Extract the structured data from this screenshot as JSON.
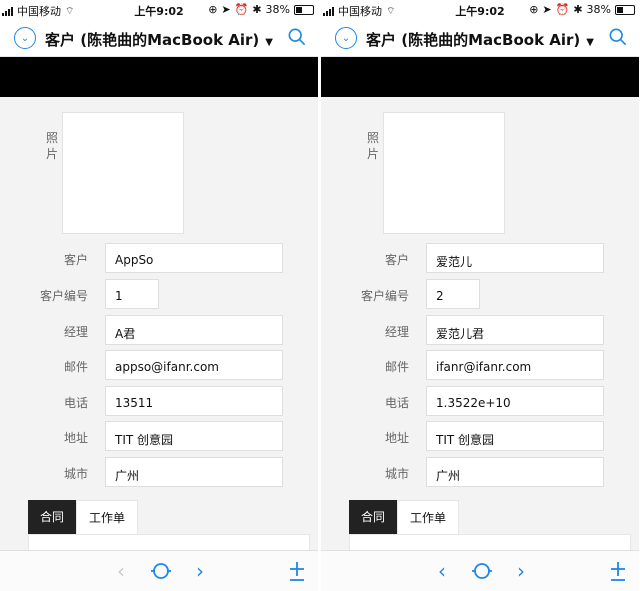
{
  "status": {
    "carrier": "中国移动",
    "time": "上午9:02",
    "battery_percent": "38%",
    "battery_level": 0.38
  },
  "navbar": {
    "title": "客户 (陈艳曲的MacBook Air)",
    "caret": "▼"
  },
  "form": {
    "photo_label": "照片",
    "labels": {
      "customer": "客户",
      "customer_number": "客户编号",
      "manager": "经理",
      "email": "邮件",
      "phone": "电话",
      "address": "地址",
      "city": "城市"
    }
  },
  "left_record": {
    "customer": "AppSo",
    "customer_number": "1",
    "manager": "A君",
    "email": "appso@ifanr.com",
    "phone": "13511",
    "address": "TIT 创意园",
    "city": "广州"
  },
  "right_record": {
    "customer": "爱范儿",
    "customer_number": "2",
    "manager": "爱范儿君",
    "email": "ifanr@ifanr.com",
    "phone": "1.3522e+10",
    "address": "TIT 创意园",
    "city": "广州"
  },
  "tabs": {
    "contract": "合同",
    "work_order": "工作单"
  },
  "toolbar": {
    "back_icon": "chevron-left-icon",
    "reload_icon": "circle-sync-icon",
    "forward_icon": "chevron-right-icon",
    "add_icon": "plus-underline-icon"
  },
  "colors": {
    "accent": "#1e88e5",
    "tab_active_bg": "#222222",
    "header_black": "#000000"
  }
}
